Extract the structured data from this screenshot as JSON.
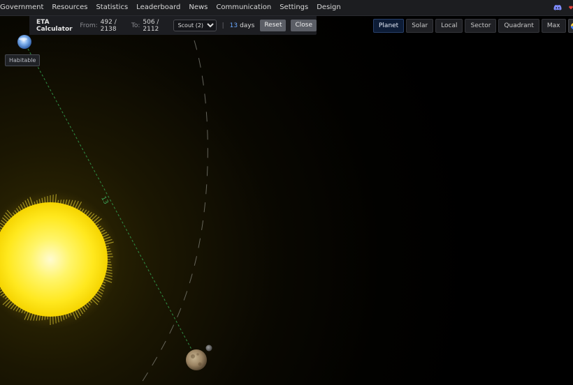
{
  "nav": {
    "items": [
      "Government",
      "Resources",
      "Statistics",
      "Leaderboard",
      "News",
      "Communication",
      "Settings",
      "Design"
    ]
  },
  "eta_calculator": {
    "title": "ETA Calculator",
    "from_label": "From:",
    "from_value": "492 / 2138",
    "to_label": "To:",
    "to_value": "506 / 2112",
    "ship_select": "Scout (2)",
    "separator": "|",
    "days_value": "13",
    "days_label": "days",
    "reset_label": "Reset",
    "close_label": "Close"
  },
  "zoom": {
    "levels": [
      "Planet",
      "Solar",
      "Local",
      "Sector",
      "Quadrant",
      "Max"
    ],
    "active": "Planet"
  },
  "map": {
    "habitable_label": "Habitable",
    "route_days_label": "13"
  },
  "colors": {
    "sun": "#fff23a",
    "route_line": "#2f8f45",
    "active_zoom": "#0d1c36",
    "days_accent": "#6aa8ff"
  }
}
